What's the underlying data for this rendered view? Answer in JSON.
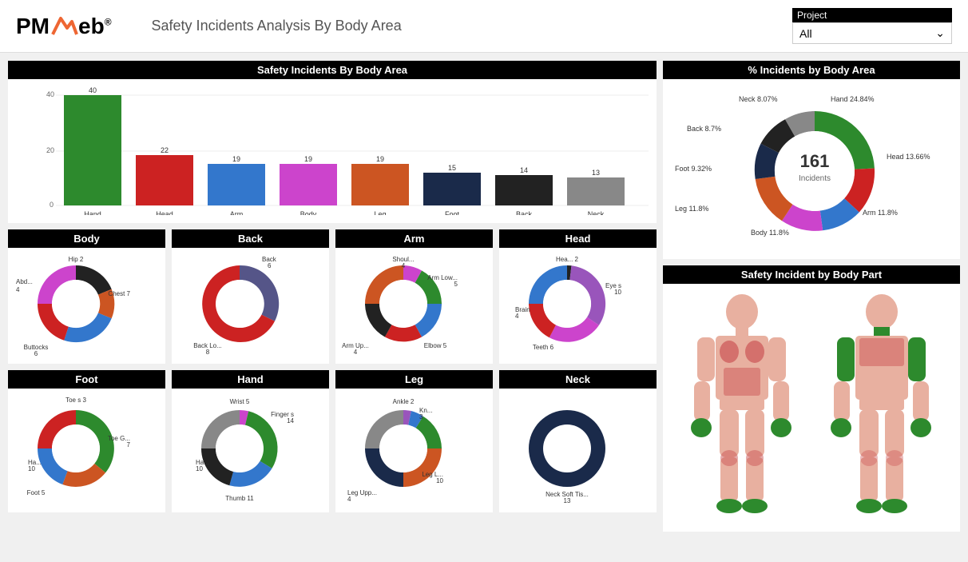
{
  "header": {
    "title": "Safety Incidents Analysis By Body Area",
    "project_label": "Project",
    "project_value": "All"
  },
  "bar_chart": {
    "title": "Safety Incidents By Body Area",
    "y_labels": [
      "40",
      "20",
      "0"
    ],
    "bars": [
      {
        "label": "Hand",
        "value": 40,
        "color": "#2d8a2d"
      },
      {
        "label": "Head",
        "value": 22,
        "color": "#cc2222"
      },
      {
        "label": "Arm",
        "value": 19,
        "color": "#3377cc"
      },
      {
        "label": "Body",
        "value": 19,
        "color": "#cc44cc"
      },
      {
        "label": "Leg",
        "value": 19,
        "color": "#cc5522"
      },
      {
        "label": "Foot",
        "value": 15,
        "color": "#1a2a4a"
      },
      {
        "label": "Back",
        "value": 14,
        "color": "#222222"
      },
      {
        "label": "Neck",
        "value": 13,
        "color": "#888888"
      }
    ],
    "max_value": 40
  },
  "pct_chart": {
    "title": "% Incidents by Body Area",
    "total": 161,
    "total_label": "Incidents",
    "segments": [
      {
        "label": "Hand",
        "pct": 24.84,
        "color": "#2d8a2d"
      },
      {
        "label": "Head",
        "pct": 13.66,
        "color": "#cc2222"
      },
      {
        "label": "Arm",
        "pct": 11.8,
        "color": "#3377cc"
      },
      {
        "label": "Body",
        "pct": 11.8,
        "color": "#cc44cc"
      },
      {
        "label": "Leg",
        "pct": 11.8,
        "color": "#cc5522"
      },
      {
        "label": "Foot",
        "pct": 9.32,
        "color": "#1a2a4a"
      },
      {
        "label": "Back",
        "pct": 8.7,
        "color": "#222222"
      },
      {
        "label": "Neck",
        "pct": 8.07,
        "color": "#888888"
      }
    ]
  },
  "donuts": {
    "body": {
      "title": "Body",
      "segments": [
        {
          "label": "Hip 2",
          "value": 2,
          "color": "#222222"
        },
        {
          "label": "Chest 7",
          "value": 7,
          "color": "#cc5522"
        },
        {
          "label": "Abd... 4",
          "value": 4,
          "color": "#3377cc"
        },
        {
          "label": "Buttocks 6",
          "value": 6,
          "color": "#cc2222"
        },
        {
          "label": "",
          "value": 0,
          "color": "#cc44cc"
        }
      ]
    },
    "back": {
      "title": "Back",
      "segments": [
        {
          "label": "Back 6",
          "value": 6,
          "color": "#555588"
        },
        {
          "label": "Back Lo... 8",
          "value": 8,
          "color": "#cc2222"
        },
        {
          "label": "",
          "value": 0,
          "color": "#888888"
        }
      ]
    },
    "arm": {
      "title": "Arm",
      "segments": [
        {
          "label": "Shoul... 4",
          "value": 4,
          "color": "#cc44cc"
        },
        {
          "label": "Arm Low... 5",
          "value": 5,
          "color": "#2d8a2d"
        },
        {
          "label": "Elbow 5",
          "value": 5,
          "color": "#3377cc"
        },
        {
          "label": "Arm Up... 4",
          "value": 4,
          "color": "#cc2222"
        },
        {
          "label": "",
          "value": 1,
          "color": "#222222"
        }
      ]
    },
    "head": {
      "title": "Head",
      "segments": [
        {
          "label": "Hea... 2",
          "value": 2,
          "color": "#222222"
        },
        {
          "label": "Eye s 10",
          "value": 10,
          "color": "#9955bb"
        },
        {
          "label": "Teeth 6",
          "value": 6,
          "color": "#cc44cc"
        },
        {
          "label": "Brain 4",
          "value": 4,
          "color": "#cc2222"
        },
        {
          "label": "",
          "value": 0,
          "color": "#3377cc"
        }
      ]
    },
    "foot": {
      "title": "Foot",
      "segments": [
        {
          "label": "Toe s 3",
          "value": 3,
          "color": "#cc2222"
        },
        {
          "label": "Toe G... 7",
          "value": 7,
          "color": "#2d8a2d"
        },
        {
          "label": "Foot 5",
          "value": 5,
          "color": "#cc5522"
        },
        {
          "label": "Ha... 10",
          "value": 10,
          "color": "#3377cc"
        }
      ]
    },
    "hand": {
      "title": "Hand",
      "segments": [
        {
          "label": "Wrist 5",
          "value": 5,
          "color": "#cc44cc"
        },
        {
          "label": "Finger s 14",
          "value": 14,
          "color": "#2d8a2d"
        },
        {
          "label": "Thumb 11",
          "value": 11,
          "color": "#3377cc"
        },
        {
          "label": "Ha... 10",
          "value": 10,
          "color": "#222222"
        }
      ]
    },
    "leg": {
      "title": "Leg",
      "segments": [
        {
          "label": "Ankle 2",
          "value": 2,
          "color": "#9955bb"
        },
        {
          "label": "Kn... 3",
          "value": 3,
          "color": "#3377cc"
        },
        {
          "label": "Leg Upp... 4",
          "value": 4,
          "color": "#2d8a2d"
        },
        {
          "label": "Leg L... 10",
          "value": 10,
          "color": "#cc5522"
        },
        {
          "label": "",
          "value": 10,
          "color": "#1a2a4a"
        }
      ]
    },
    "neck": {
      "title": "Neck",
      "segments": [
        {
          "label": "Neck Soft Tis... 13",
          "value": 13,
          "color": "#1a2a4a"
        }
      ]
    }
  },
  "body_diagram": {
    "title": "Safety Incident by Body Part"
  }
}
